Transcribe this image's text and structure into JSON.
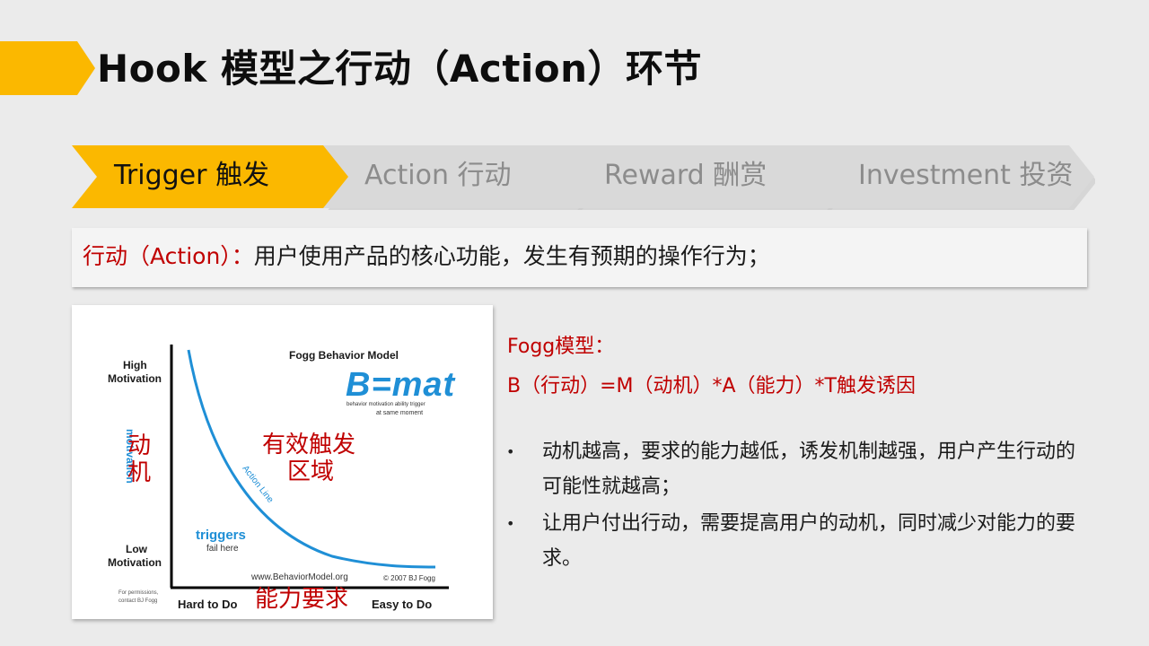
{
  "slide": {
    "title": "Hook 模型之行动（Action）环节",
    "colors": {
      "accent_yellow": "#fbb800",
      "step_inactive_bg": "#d9d9d9",
      "red_text": "#c00000",
      "chart_blue": "#1f8fd6"
    }
  },
  "steps": [
    {
      "label": "Trigger 触发",
      "active": true
    },
    {
      "label": "Action 行动",
      "active": false
    },
    {
      "label": "Reward 酬赏",
      "active": false
    },
    {
      "label": "Investment 投资",
      "active": false
    }
  ],
  "definition": {
    "term": "行动（Action）：",
    "text": "用户使用产品的核心功能，发生有预期的操作行为；"
  },
  "figure": {
    "title": "Fogg Behavior Model",
    "logo_text": "B=mat",
    "logo_caption_1": "behavior  motivation  ability  trigger",
    "logo_caption_2": "at same moment",
    "high_motivation_1": "High",
    "high_motivation_2": "Motivation",
    "low_motivation_1": "Low",
    "low_motivation_2": "Motivation",
    "hard_to_do": "Hard to Do",
    "easy_to_do": "Easy to Do",
    "action_line": "Action Line",
    "triggers": "triggers",
    "fail_here": "fail here",
    "website": "www.BehaviorModel.org",
    "copyright": "© 2007 BJ Fogg",
    "permissions_1": "For permissions,",
    "permissions_2": "contact BJ Fogg",
    "y_axis_word": "motivation",
    "overlay_y_label_1": "动",
    "overlay_y_label_2": "机",
    "overlay_region_1": "有效触发",
    "overlay_region_2": "区域",
    "overlay_x_label": "能力要求"
  },
  "fogg": {
    "title": "Fogg模型：",
    "formula": "B（行动）=M（动机）*A（能力）*T触发诱因"
  },
  "bullets": [
    {
      "marker": "•",
      "text": "动机越高，要求的能力越低，诱发机制越强，用户产生行动的可能性就越高；"
    },
    {
      "marker": "•",
      "text": "让用户付出行动，需要提高用户的动机，同时减少对能力的要求。"
    }
  ]
}
